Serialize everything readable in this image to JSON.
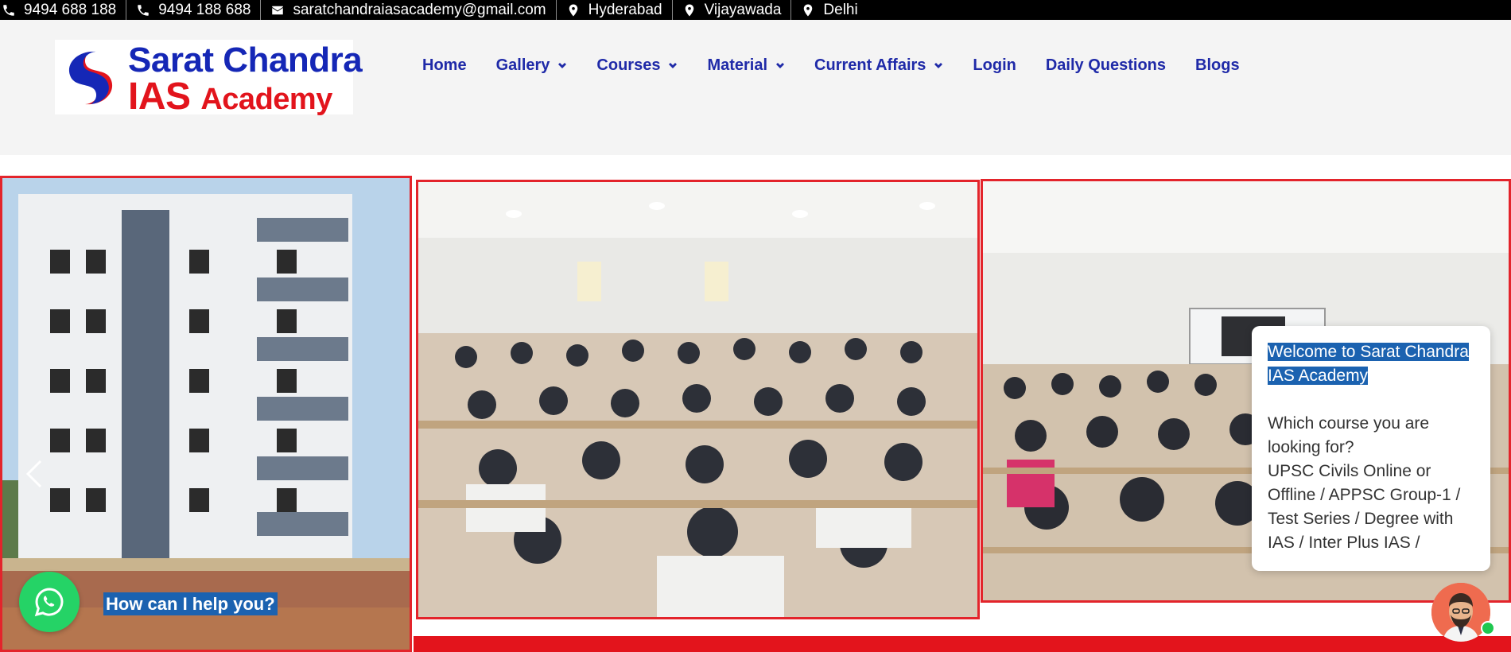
{
  "topbar": {
    "phone1": "9494 688 188",
    "phone2": "9494 188 688",
    "email": "saratchandraiasacademy@gmail.com",
    "locations": [
      "Hyderabad",
      "Vijayawada",
      "Delhi"
    ]
  },
  "logo": {
    "line1": "Sarat Chandra",
    "line2_big": "IAS",
    "line2_small": "Academy"
  },
  "nav": {
    "items": [
      {
        "label": "Home",
        "dropdown": false
      },
      {
        "label": "Gallery",
        "dropdown": true
      },
      {
        "label": "Courses",
        "dropdown": true
      },
      {
        "label": "Material",
        "dropdown": true
      },
      {
        "label": "Current Affairs",
        "dropdown": true
      },
      {
        "label": "Login",
        "dropdown": false
      },
      {
        "label": "Daily Questions",
        "dropdown": false
      },
      {
        "label": "Blogs",
        "dropdown": false
      }
    ]
  },
  "whatsapp": {
    "label": "How can I help you?"
  },
  "chat": {
    "welcome": "Welcome to Sarat Chandra IAS Academy",
    "question": "Which course you are looking for?",
    "options": "UPSC Civils Online or Offline / APPSC Group-1 / Test Series / Degree with IAS / Inter Plus IAS /"
  },
  "colors": {
    "nav_text": "#1f2aa8",
    "accent_red": "#e3141c",
    "whatsapp_green": "#25d366",
    "highlight_blue": "#1b62b0"
  }
}
